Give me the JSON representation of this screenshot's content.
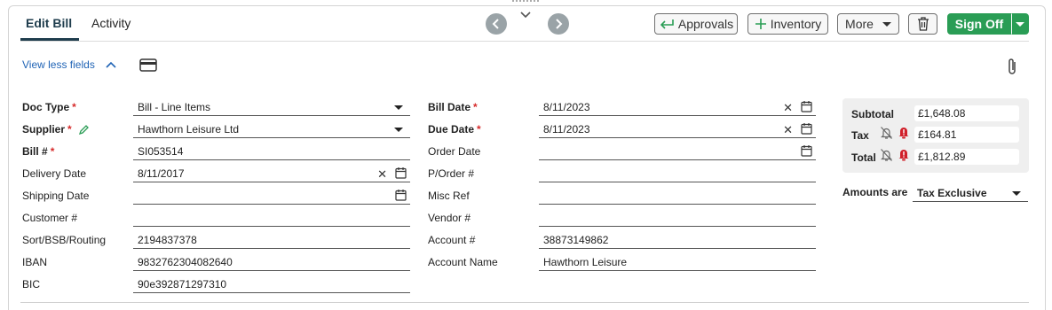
{
  "tabs": [
    {
      "label": "Edit Bill",
      "active": true
    },
    {
      "label": "Activity",
      "active": false
    }
  ],
  "toolbar": {
    "approvals": "Approvals",
    "inventory": "Inventory",
    "more": "More",
    "sign_off": "Sign Off"
  },
  "view_less": "View less fields",
  "fields_left": [
    {
      "label": "Doc Type",
      "required": true,
      "value": "Bill - Line Items"
    },
    {
      "label": "Supplier",
      "required": true,
      "value": "Hawthorn Leisure Ltd"
    },
    {
      "label": "Bill #",
      "required": true,
      "value": "SI053514"
    },
    {
      "label": "Delivery Date",
      "required": false,
      "value": "8/11/2017"
    },
    {
      "label": "Shipping Date",
      "required": false,
      "value": ""
    },
    {
      "label": "Customer #",
      "required": false,
      "value": ""
    },
    {
      "label": "Sort/BSB/Routing",
      "required": false,
      "value": "2194837378"
    },
    {
      "label": "IBAN",
      "required": false,
      "value": "9832762304082640"
    },
    {
      "label": "BIC",
      "required": false,
      "value": "90e392871297310"
    }
  ],
  "fields_mid": [
    {
      "label": "Bill Date",
      "required": true,
      "value": "8/11/2023"
    },
    {
      "label": "Due Date",
      "required": true,
      "value": "8/11/2023"
    },
    {
      "label": "Order Date",
      "required": false,
      "value": ""
    },
    {
      "label": "P/Order #",
      "required": false,
      "value": ""
    },
    {
      "label": "Misc Ref",
      "required": false,
      "value": ""
    },
    {
      "label": "Vendor #",
      "required": false,
      "value": ""
    },
    {
      "label": "Account #",
      "required": false,
      "value": "38873149862"
    },
    {
      "label": "Account Name",
      "required": false,
      "value": "Hawthorn Leisure"
    }
  ],
  "required_mark": "*",
  "totals": {
    "subtotal_label": "Subtotal",
    "subtotal": "£1,648.08",
    "tax_label": "Tax",
    "tax": "£164.81",
    "total_label": "Total",
    "total": "£1,812.89"
  },
  "amounts_are": {
    "label": "Amounts are",
    "value": "Tax Exclusive"
  },
  "colors": {
    "accent": "#1f3d4d",
    "link": "#1f63b5",
    "sign_off": "#2a9d55",
    "required": "#d62b2b",
    "alert": "#d0202a"
  }
}
